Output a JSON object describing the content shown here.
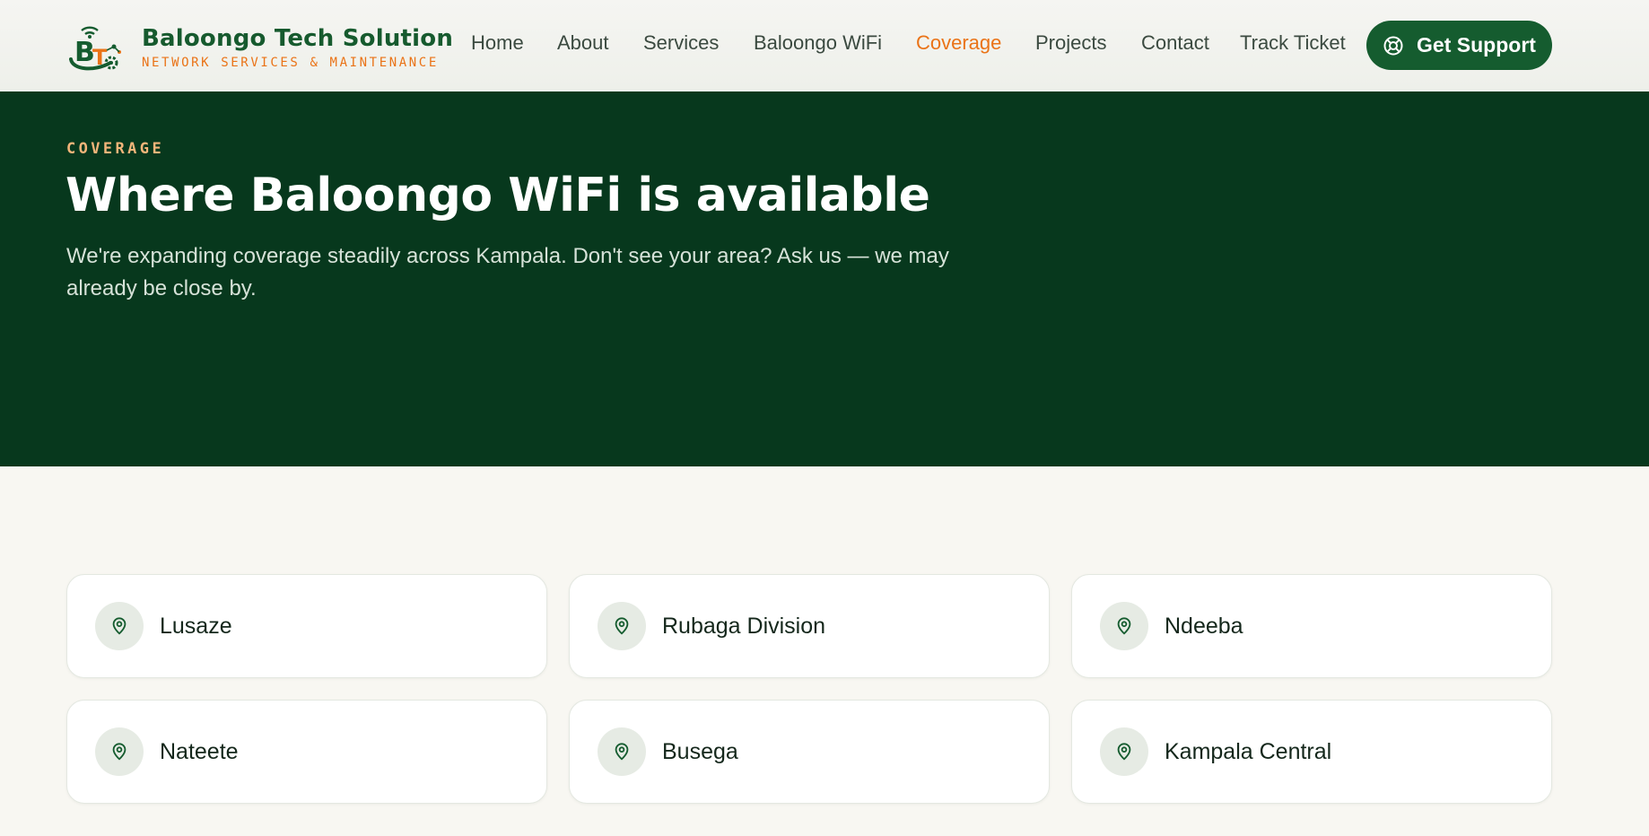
{
  "brand": {
    "name": "Baloongo Tech Solution",
    "tagline": "NETWORK SERVICES & MAINTENANCE",
    "colors": {
      "primary": "#155c2f",
      "accent": "#ea7317"
    }
  },
  "nav": {
    "items": [
      {
        "label": "Home",
        "active": false
      },
      {
        "label": "About",
        "active": false
      },
      {
        "label": "Services",
        "active": false
      },
      {
        "label": "Baloongo WiFi",
        "active": false
      },
      {
        "label": "Coverage",
        "active": true
      },
      {
        "label": "Projects",
        "active": false
      },
      {
        "label": "Contact",
        "active": false
      },
      {
        "label": "Track Ticket",
        "active": false
      }
    ],
    "cta": {
      "label": "Get Support",
      "icon": "lifebuoy-icon"
    }
  },
  "hero": {
    "eyebrow": "COVERAGE",
    "title": "Where Baloongo WiFi is available",
    "description": "We're expanding coverage steadily across Kampala. Don't see your area? Ask us — we may already be close by."
  },
  "coverage": {
    "icon": "map-pin-icon",
    "areas": [
      "Lusaze",
      "Rubaga Division",
      "Ndeeba",
      "Nateete",
      "Busega",
      "Kampala Central"
    ]
  }
}
